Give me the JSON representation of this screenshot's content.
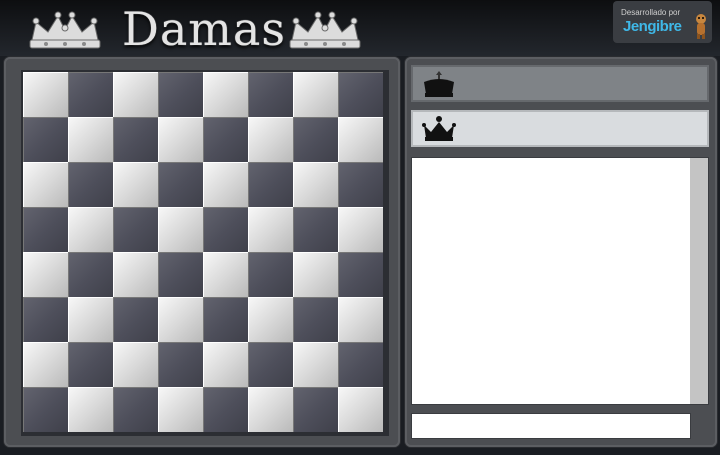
{
  "header": {
    "title": "Damas",
    "credit_text": "Desarrollado por",
    "credit_brand": "Jengibre",
    "decor_icon": "crown-icon"
  },
  "board": {
    "rows": 8,
    "cols": 8,
    "top_left_color": "light",
    "light_color": "#e6e6e6",
    "dark_color": "#52535f"
  },
  "players": [
    {
      "icon": "black-crown-icon",
      "name": "",
      "highlight": true
    },
    {
      "icon": "black-crown-icon",
      "name": "",
      "highlight": false
    }
  ],
  "chat": {
    "messages": [],
    "input_value": "",
    "input_placeholder": ""
  },
  "colors": {
    "background": "#1a1d22",
    "panel": "#4c4e52",
    "brand": "#3fb8e8"
  }
}
